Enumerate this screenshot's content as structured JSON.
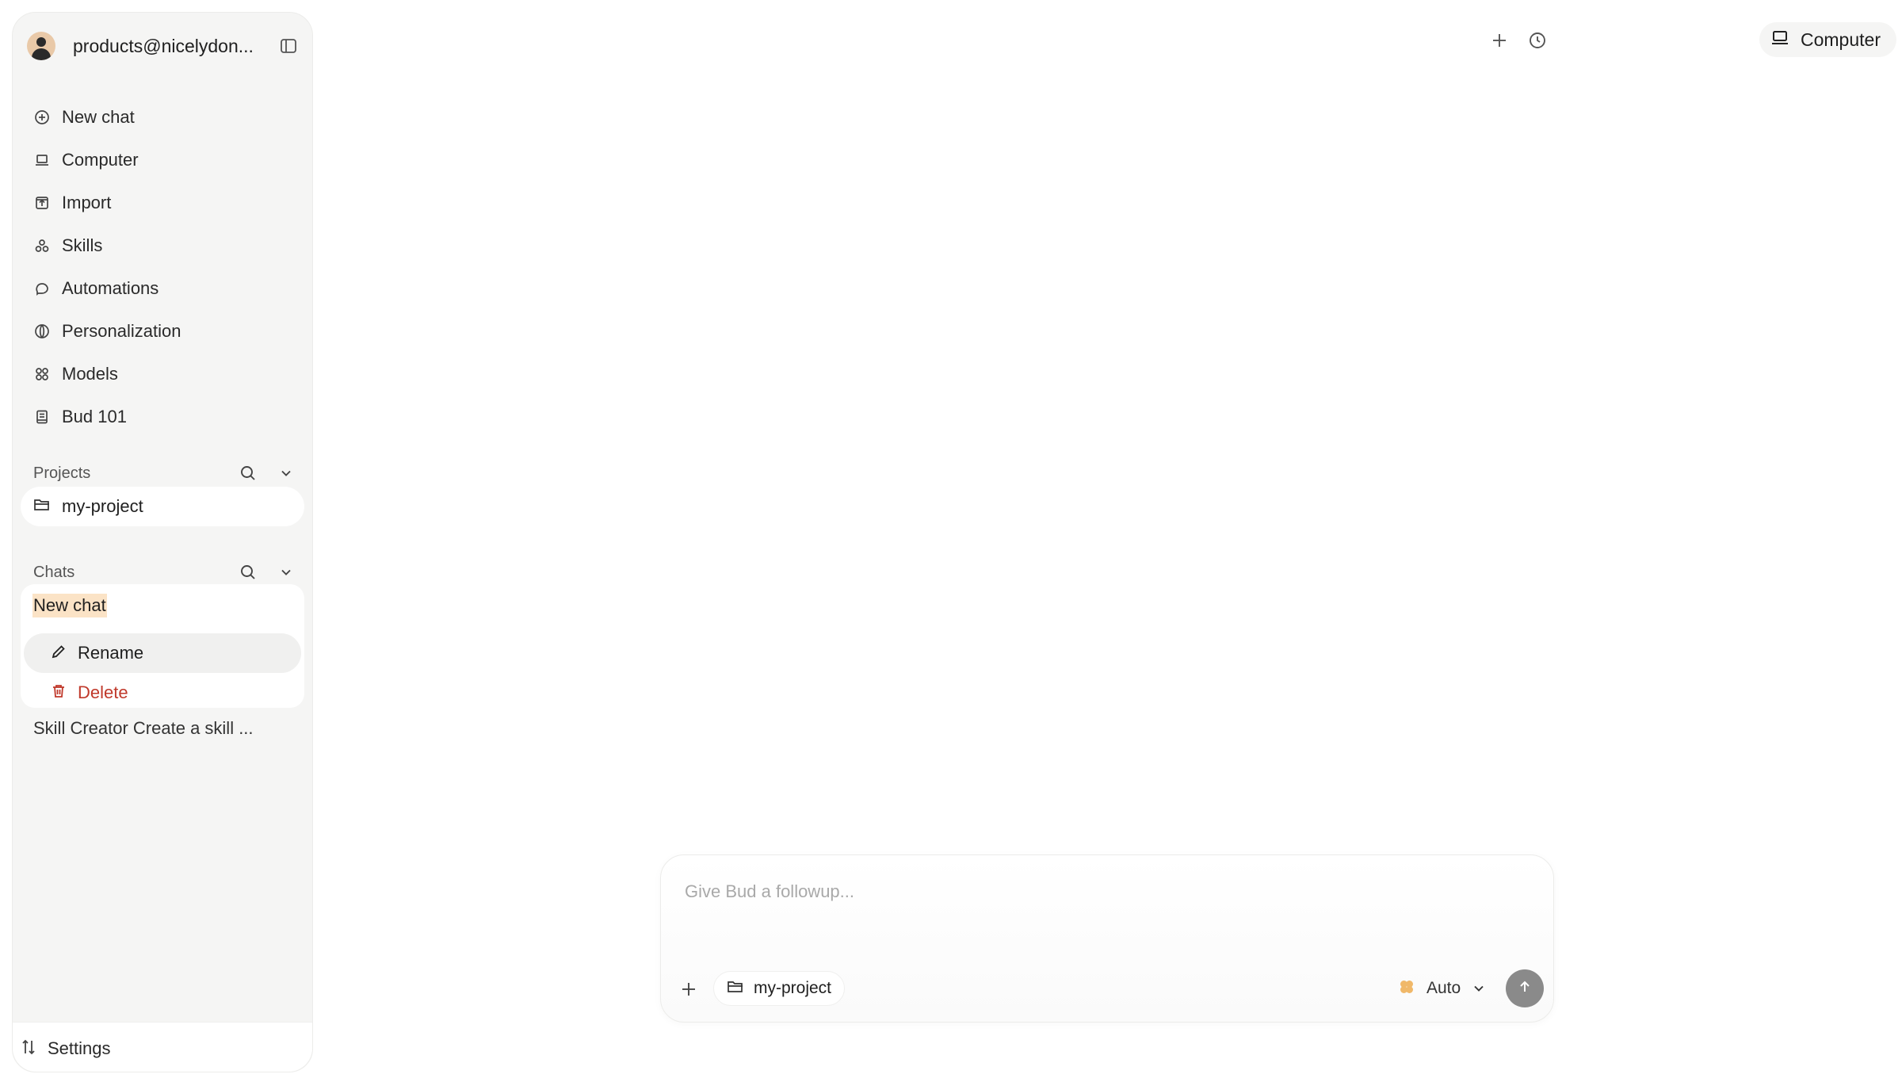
{
  "account": {
    "name": "products@nicelydon..."
  },
  "nav": {
    "items": [
      {
        "label": "New chat",
        "icon": "plus-circle-icon"
      },
      {
        "label": "Computer",
        "icon": "laptop-icon"
      },
      {
        "label": "Import",
        "icon": "import-icon"
      },
      {
        "label": "Skills",
        "icon": "skills-icon"
      },
      {
        "label": "Automations",
        "icon": "automations-icon"
      },
      {
        "label": "Personalization",
        "icon": "personalization-icon"
      },
      {
        "label": "Models",
        "icon": "models-icon"
      },
      {
        "label": "Bud 101",
        "icon": "book-icon"
      }
    ]
  },
  "projects": {
    "title": "Projects",
    "items": [
      {
        "label": "my-project",
        "icon": "folder-icon"
      }
    ]
  },
  "chats": {
    "title": "Chats",
    "active": {
      "title": "New chat"
    },
    "context_menu": {
      "rename": "Rename",
      "delete": "Delete"
    },
    "items": [
      {
        "label": "Skill Creator Create a skill ..."
      }
    ]
  },
  "settings": {
    "label": "Settings"
  },
  "header": {
    "computer_label": "Computer"
  },
  "composer": {
    "placeholder": "Give Bud a followup...",
    "value": "",
    "project_label": "my-project",
    "model_label": "Auto"
  },
  "colors": {
    "sidebar_bg": "#f5f5f4",
    "highlight": "#fbe3c6",
    "delete_red": "#c0392b",
    "send_button": "#8a8a8a",
    "model_icon": "#f0b869"
  }
}
